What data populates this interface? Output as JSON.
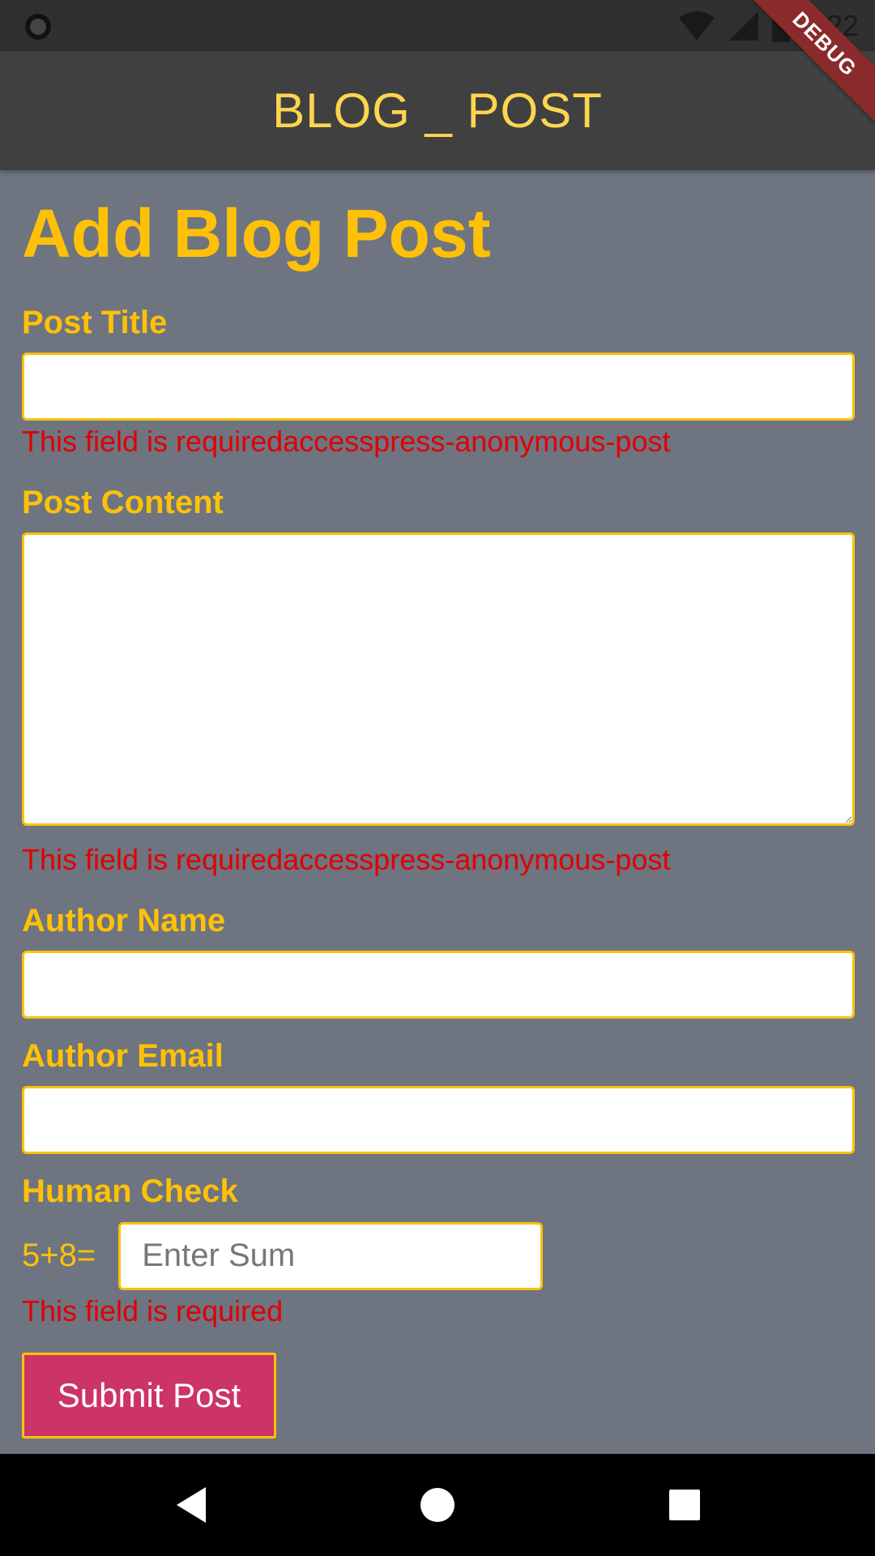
{
  "status_bar": {
    "time": "5:22",
    "debug_label": "DEBUG"
  },
  "app_bar": {
    "title": "BLOG _ POST"
  },
  "form": {
    "heading": "Add Blog Post",
    "post_title": {
      "label": "Post Title",
      "value": "",
      "error": "This field is requiredaccesspress-anonymous-post"
    },
    "post_content": {
      "label": "Post Content",
      "value": "",
      "error": "This field is requiredaccesspress-anonymous-post"
    },
    "author_name": {
      "label": "Author Name",
      "value": ""
    },
    "author_email": {
      "label": "Author Email",
      "value": ""
    },
    "human_check": {
      "label": "Human Check",
      "question": "5+8=",
      "placeholder": "Enter Sum",
      "value": "",
      "error": "This field is required"
    },
    "submit_label": "Submit Post"
  },
  "colors": {
    "accent": "#ffc107",
    "app_bar_title": "#ffd54f",
    "background": "#6e7480",
    "app_bar": "#404040",
    "error": "#e00000",
    "submit_button": "#cc3366"
  }
}
